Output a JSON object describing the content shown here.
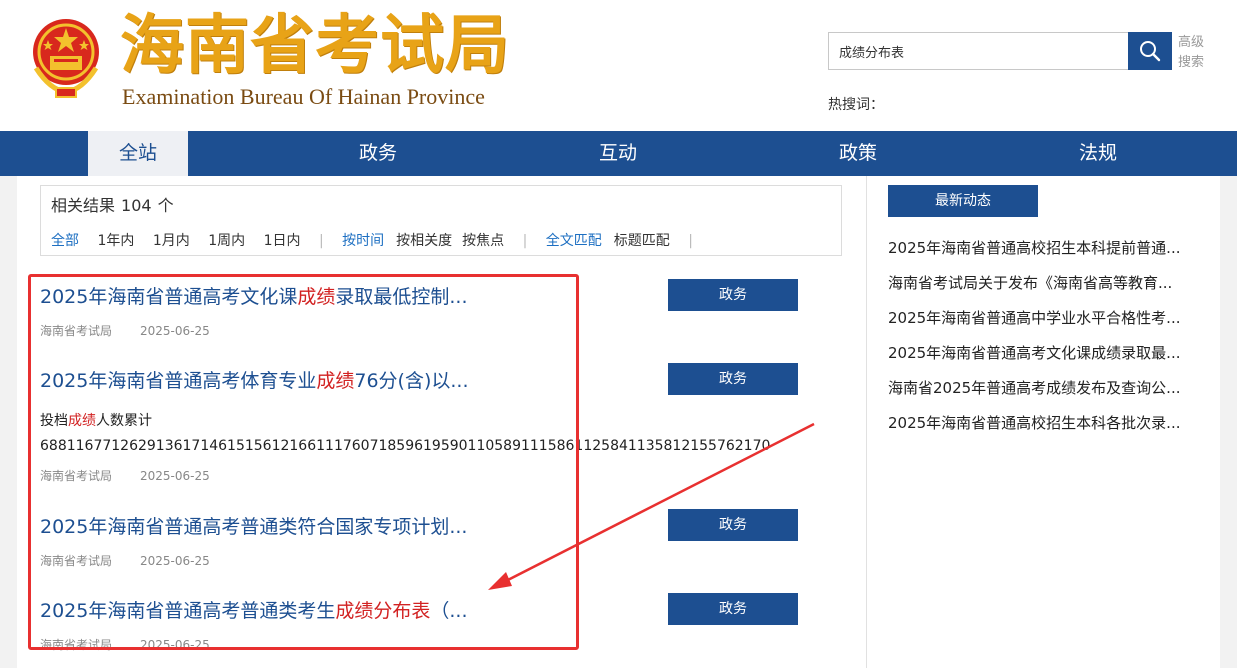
{
  "header": {
    "logo_cn": "海南省考试局",
    "logo_en": "Examination Bureau Of Hainan Province",
    "search_value": "成绩分布表",
    "advanced_search": "高级搜索",
    "hot_words_label": "热搜词："
  },
  "nav": {
    "items": [
      "全站",
      "政务",
      "互动",
      "政策",
      "法规"
    ],
    "active": "全站"
  },
  "filter": {
    "result_label": "相关结果",
    "result_count": "104",
    "result_unit": "个",
    "time_options": [
      "全部",
      "1年内",
      "1月内",
      "1周内",
      "1日内"
    ],
    "sort_options": [
      "按时间",
      "按相关度",
      "按焦点"
    ],
    "match_options": [
      "全文匹配",
      "标题匹配"
    ]
  },
  "results": [
    {
      "title_pre": "2025年海南省普通高考文化课",
      "title_hl": "成绩",
      "title_post": "录取最低控制...",
      "source": "海南省考试局",
      "date": "2025-06-25",
      "tag": "政务"
    },
    {
      "title_pre": "2025年海南省普通高考体育专业",
      "title_hl": "成绩",
      "title_post": "76分(含)以...",
      "snippet_pre": "投档",
      "snippet_hl": "成绩",
      "snippet_post": "人数累计",
      "snippet_numbers": "6881167712629136171461515612166111760718596195901105891115861125841135812155762170",
      "source": "海南省考试局",
      "date": "2025-06-25",
      "tag": "政务"
    },
    {
      "title_pre": "2025年海南省普通高考普通类符合国家专项计划...",
      "title_hl": "",
      "title_post": "",
      "source": "海南省考试局",
      "date": "2025-06-25",
      "tag": "政务"
    },
    {
      "title_pre": "2025年海南省普通高考普通类考生",
      "title_hl": "成绩分布表",
      "title_post": "（...",
      "source": "海南省考试局",
      "date": "2025-06-25",
      "tag": "政务"
    }
  ],
  "latest": {
    "heading": "最新动态",
    "items": [
      "2025年海南省普通高校招生本科提前普通...",
      "海南省考试局关于发布《海南省高等教育...",
      "2025年海南省普通高中学业水平合格性考...",
      "2025年海南省普通高考文化课成绩录取最...",
      "海南省2025年普通高考成绩发布及查询公...",
      "2025年海南省普通高校招生本科各批次录..."
    ]
  },
  "colors": {
    "nav_blue": "#1d4f91",
    "highlight_red": "#d22222",
    "logo_gold": "#e8a317",
    "annotation_red": "#e83030"
  }
}
